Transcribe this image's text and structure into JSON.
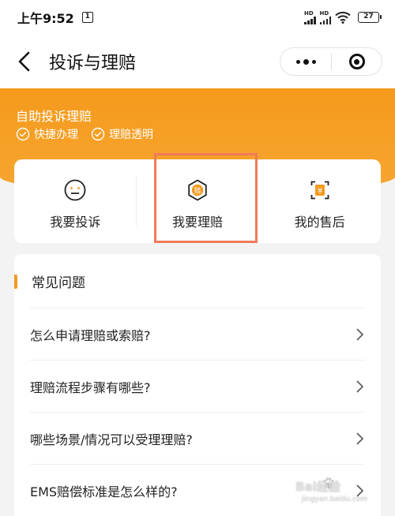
{
  "status_bar": {
    "time": "上午9:52",
    "sim_label": "1",
    "signal_1_label": "HD",
    "signal_2_label": "HD",
    "battery": "27"
  },
  "nav": {
    "title": "投诉与理赔"
  },
  "banner": {
    "title": "自助投诉理赔",
    "tags": [
      "快捷办理",
      "理赔透明"
    ]
  },
  "actions": [
    {
      "label": "我要投诉",
      "icon": "face-icon"
    },
    {
      "label": "我要理赔",
      "icon": "claim-badge-icon"
    },
    {
      "label": "我的售后",
      "icon": "after-sales-icon"
    }
  ],
  "faq": {
    "title": "常见问题",
    "items": [
      "怎么申请理赔或索赔?",
      "理赔流程步骤有哪些?",
      "哪些场景/情况可以受理理赔?",
      "EMS赔偿标准是怎么样的?"
    ]
  },
  "watermark": {
    "brand": "Bai经验",
    "url": "jingyan.baidu.com"
  },
  "colors": {
    "accent": "#f59a1c",
    "highlight_box": "#f07a5c"
  }
}
